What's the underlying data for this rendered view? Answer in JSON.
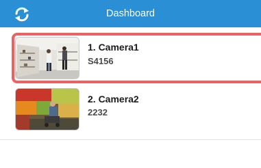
{
  "header": {
    "title": "Dashboard",
    "refresh_icon": "refresh-icon",
    "background": "#2b8fd5"
  },
  "cameras": [
    {
      "name": "1. Camera1",
      "id": "S4156",
      "selected": true,
      "thumbnail": "store-interior-image"
    },
    {
      "name": "2. Camera2",
      "id": "2232",
      "selected": false,
      "thumbnail": "produce-market-image"
    }
  ],
  "colors": {
    "selection_border": "#ec6262",
    "text_primary": "#1b1b1b"
  }
}
